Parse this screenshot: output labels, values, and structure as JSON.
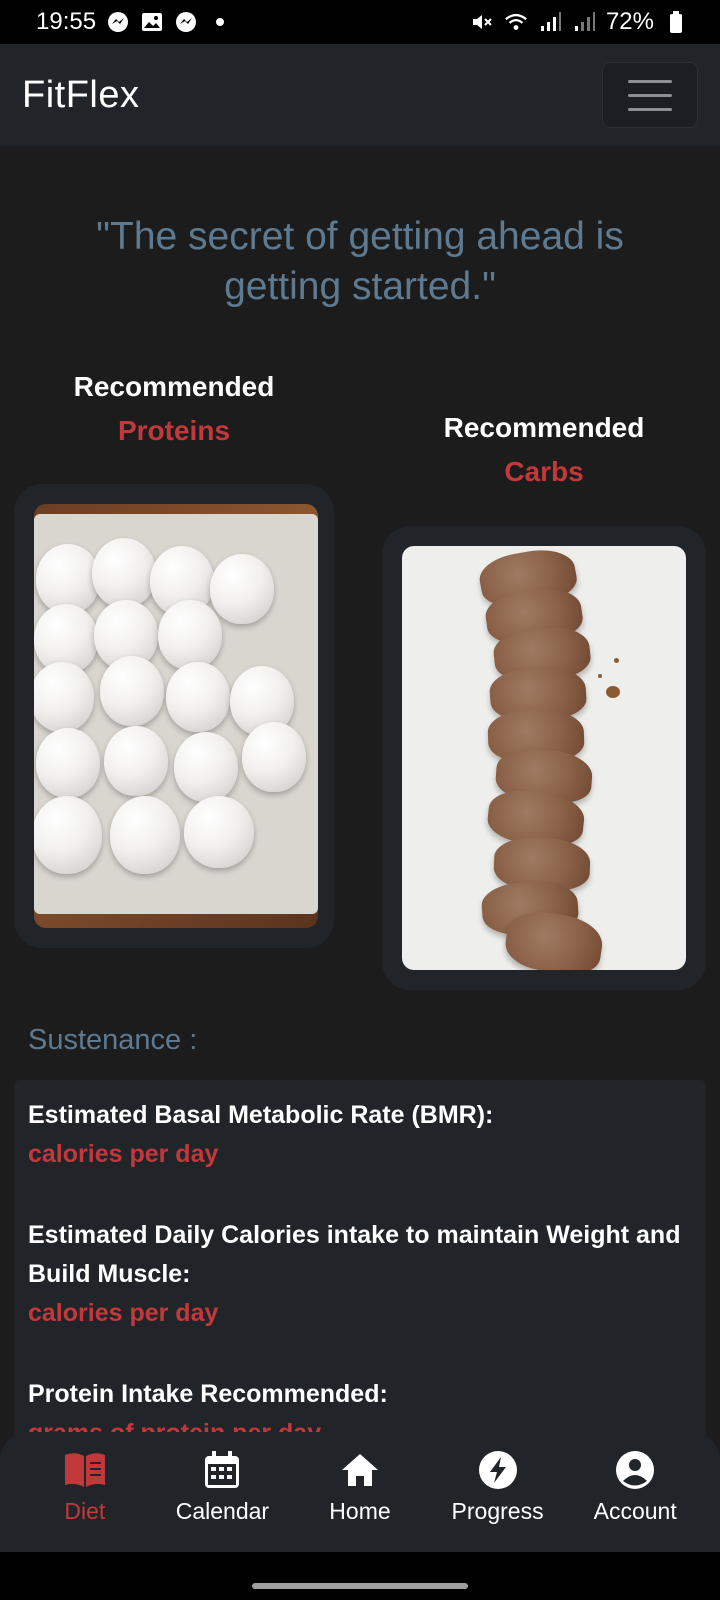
{
  "status_bar": {
    "time": "19:55",
    "battery": "72%",
    "icons": [
      "messenger-icon",
      "gallery-icon",
      "messenger-icon",
      "dot-icon",
      "mute-icon",
      "wifi-icon",
      "signal-icon",
      "signal-icon",
      "battery-icon"
    ]
  },
  "navbar": {
    "brand": "FitFlex",
    "menu_icon": "hamburger-menu-icon"
  },
  "quote": "\"The secret of getting ahead is getting started.\"",
  "recommendations": [
    {
      "title": "Recommended",
      "subtitle": "Proteins",
      "image": "eggs-in-tray-photo"
    },
    {
      "title": "Recommended",
      "subtitle": "Carbs",
      "image": "sliced-bread-photo"
    }
  ],
  "sustenance": {
    "title": "Sustenance :",
    "items": [
      {
        "label": "Estimated Basal Metabolic Rate (BMR):",
        "value": "calories per day"
      },
      {
        "label": "Estimated Daily Calories intake to maintain Weight and Build Muscle:",
        "value": "calories per day"
      },
      {
        "label": "Protein Intake Recommended:",
        "value": "grams of protein per day"
      }
    ]
  },
  "bottom_nav": {
    "items": [
      {
        "label": "Diet",
        "icon": "book-icon",
        "active": true
      },
      {
        "label": "Calendar",
        "icon": "calendar-icon",
        "active": false
      },
      {
        "label": "Home",
        "icon": "home-icon",
        "active": false
      },
      {
        "label": "Progress",
        "icon": "lightning-icon",
        "active": false
      },
      {
        "label": "Account",
        "icon": "account-icon",
        "active": false
      }
    ]
  },
  "colors": {
    "background": "#1c1c1c",
    "panel": "#212529",
    "accent_red": "#c2393b",
    "quote_blue": "#5e7a91"
  }
}
